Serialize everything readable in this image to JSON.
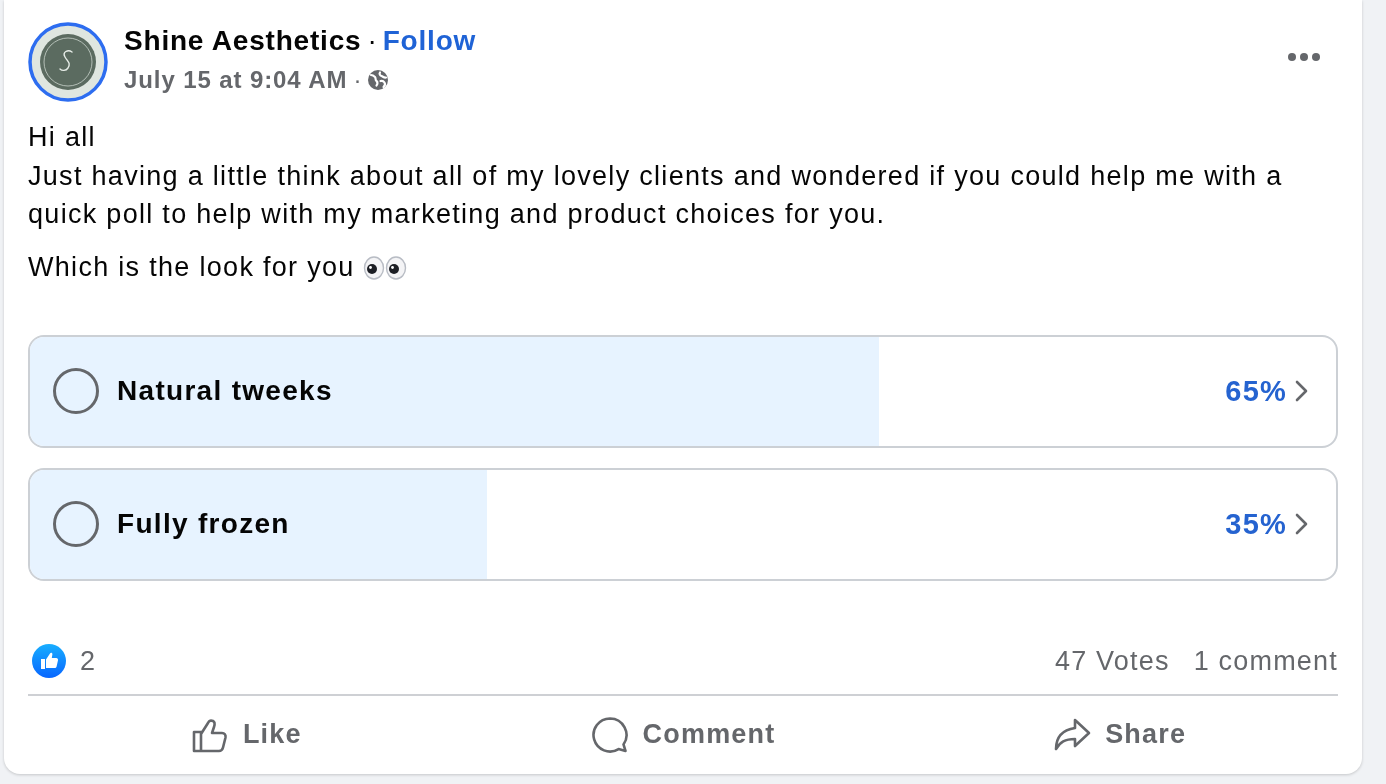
{
  "post": {
    "author": "Shine Aesthetics",
    "author_separator": "·",
    "follow": "Follow",
    "timestamp": "July 15 at 9:04 AM",
    "timestamp_separator": "·"
  },
  "body": {
    "lines": [
      "Hi all",
      "Just having a little think about all of my lovely clients and wondered if you could help me with a quick poll to help with my marketing and product choices for you."
    ],
    "question": "Which is the look for you"
  },
  "poll": {
    "options": [
      {
        "label": "Natural tweeks",
        "percent": "65%",
        "level": 0.65,
        "selected": false
      },
      {
        "label": "Fully frozen",
        "percent": "35%",
        "level": 0.35,
        "selected": false
      }
    ]
  },
  "stats": {
    "reactions": "2",
    "votes": "47 Votes",
    "comments": "1 comment"
  },
  "actions": [
    {
      "kind": "like",
      "label": "Like"
    },
    {
      "kind": "comment",
      "label": "Comment"
    },
    {
      "kind": "share",
      "label": "Share"
    }
  ]
}
